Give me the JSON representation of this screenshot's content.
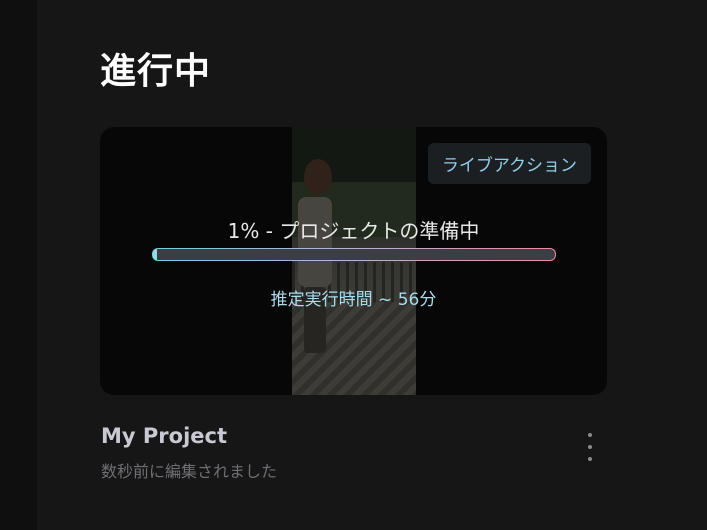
{
  "section": {
    "title": "進行中"
  },
  "card": {
    "badge": "ライブアクション",
    "status_text": "1% - プロジェクトの準備中",
    "progress_percent": 1,
    "eta_text": "推定実行時間 ~ 56分"
  },
  "project": {
    "name": "My Project",
    "edited": "数秒前に編集されました"
  },
  "icons": {
    "more": "more-vertical-icon"
  },
  "colors": {
    "accent": "#8ecfe9",
    "background": "#161616",
    "card": "#070707"
  }
}
